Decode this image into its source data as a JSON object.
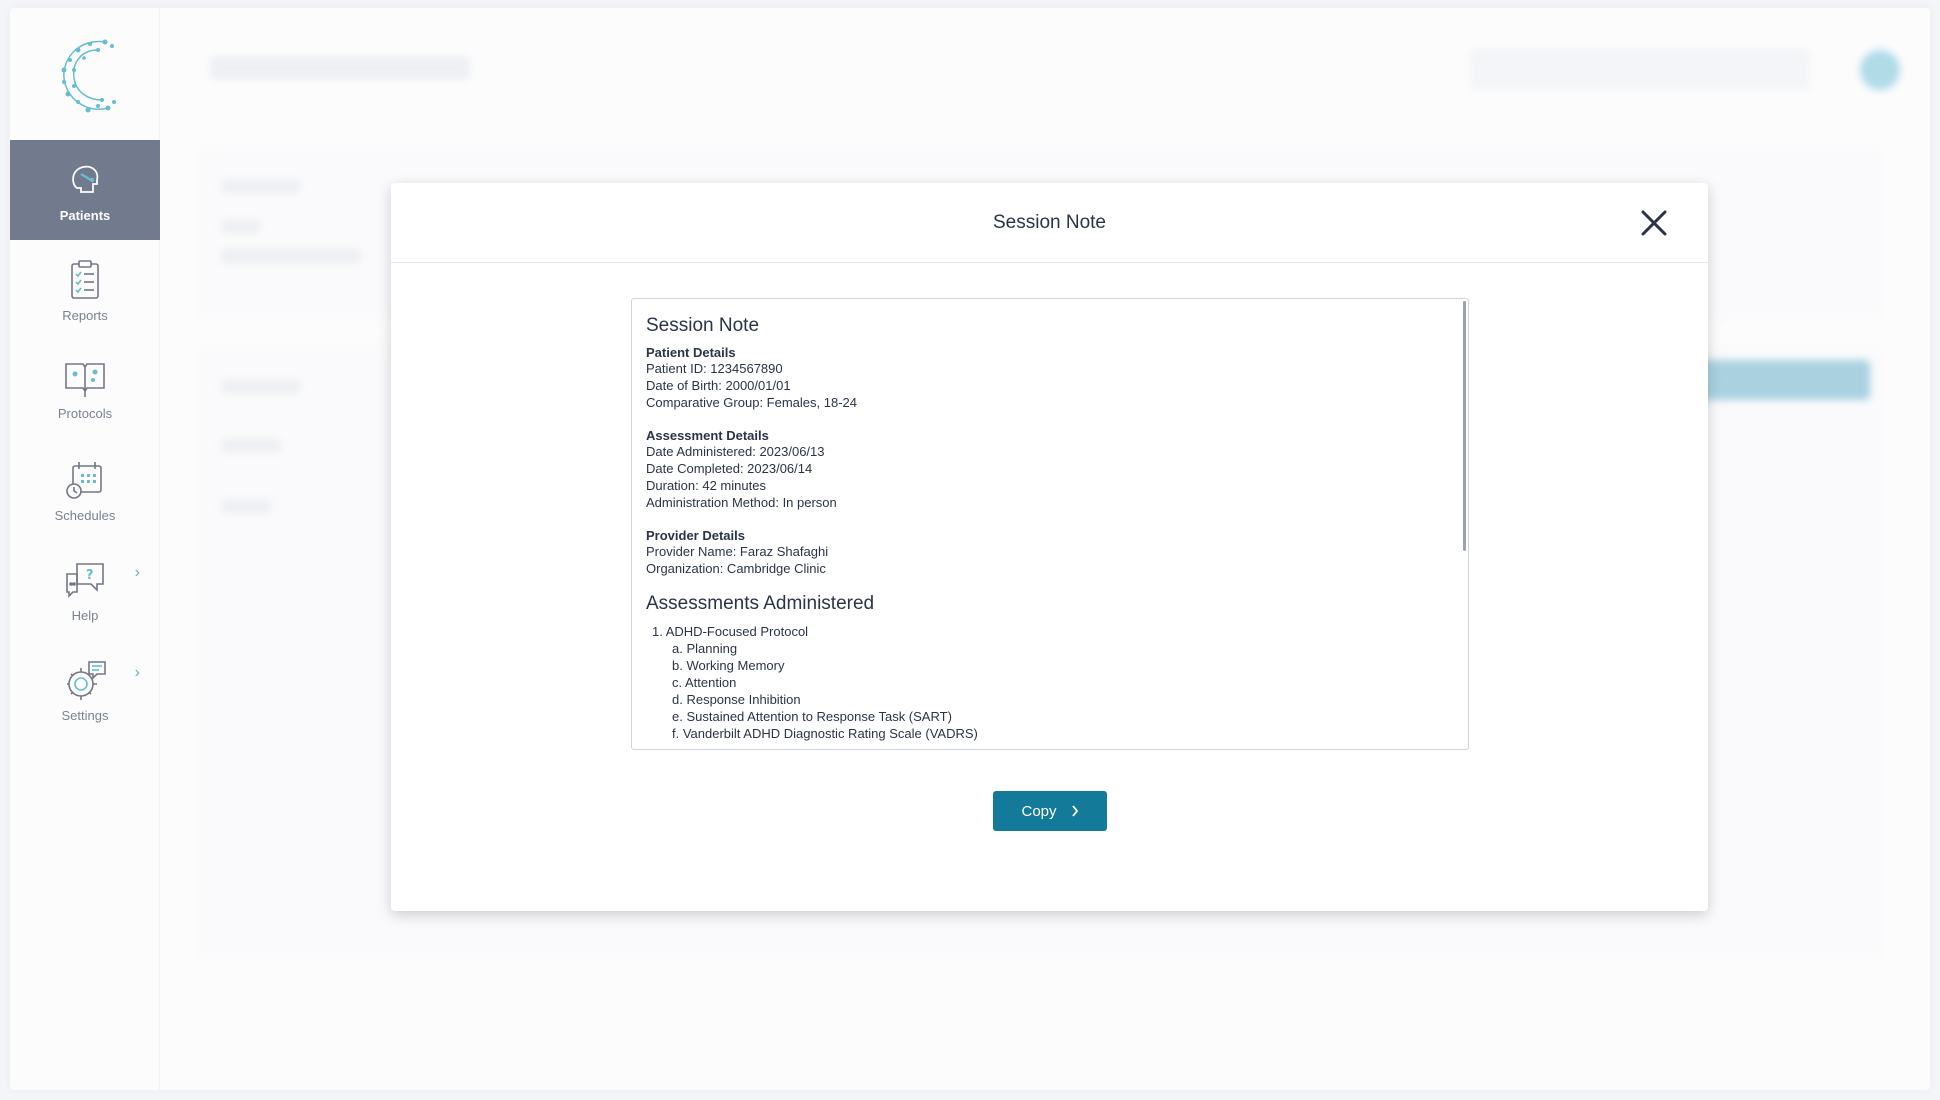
{
  "sidebar": {
    "items": [
      {
        "label": "Patients",
        "icon": "patient-head-icon",
        "active": true
      },
      {
        "label": "Reports",
        "icon": "clipboard-checklist-icon"
      },
      {
        "label": "Protocols",
        "icon": "open-book-icon"
      },
      {
        "label": "Schedules",
        "icon": "calendar-clock-icon"
      },
      {
        "label": "Help",
        "icon": "question-chat-icon",
        "has_submenu": true
      },
      {
        "label": "Settings",
        "icon": "gear-chat-icon",
        "has_submenu": true
      }
    ]
  },
  "modal": {
    "title": "Session Note",
    "note": {
      "heading": "Session Note",
      "patient_details": {
        "title": "Patient Details",
        "lines": [
          "Patient ID: 1234567890",
          "Date of Birth: 2000/01/01",
          "Comparative Group: Females, 18-24"
        ]
      },
      "assessment_details": {
        "title": "Assessment Details",
        "lines": [
          "Date Administered: 2023/06/13",
          "Date Completed: 2023/06/14",
          "Duration: 42 minutes",
          "Administration Method: In person"
        ]
      },
      "provider_details": {
        "title": "Provider Details",
        "lines": [
          "Provider Name: Faraz Shafaghi",
          "Organization: Cambridge Clinic"
        ]
      },
      "assessments_heading": "Assessments Administered",
      "assessments": [
        {
          "label": "1. ADHD-Focused Protocol",
          "items": [
            "a. Planning",
            "b. Working Memory",
            "c. Attention",
            "d. Response Inhibition",
            "e. Sustained Attention to Response Task (SART)",
            "f. Vanderbilt ADHD Diagnostic Rating Scale (VADRS)"
          ]
        }
      ]
    },
    "copy_label": "Copy"
  },
  "colors": {
    "sidebar_active": "#2b3a55",
    "accent": "#137a9a",
    "teal": "#1aa0b8"
  }
}
